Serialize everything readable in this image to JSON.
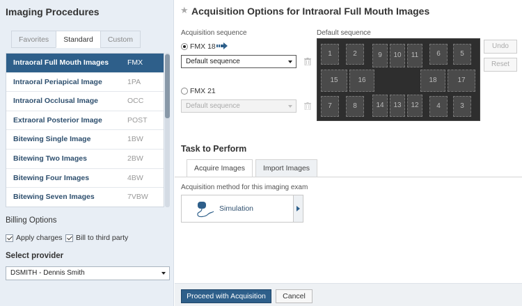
{
  "left": {
    "title": "Imaging Procedures",
    "tabs": [
      "Favorites",
      "Standard",
      "Custom"
    ],
    "procedures": [
      {
        "name": "Intraoral Full Mouth Images",
        "code": "FMX",
        "selected": true
      },
      {
        "name": "Intraoral Periapical Image",
        "code": "1PA"
      },
      {
        "name": "Intraoral Occlusal Image",
        "code": "OCC"
      },
      {
        "name": "Extraoral Posterior Image",
        "code": "POST"
      },
      {
        "name": "Bitewing Single Image",
        "code": "1BW"
      },
      {
        "name": "Bitewing Two Images",
        "code": "2BW"
      },
      {
        "name": "Bitewing Four Images",
        "code": "4BW"
      },
      {
        "name": "Bitewing Seven Images",
        "code": "7VBW"
      }
    ],
    "billing_title": "Billing Options",
    "apply_charges": "Apply charges",
    "bill_third_party": "Bill to third party",
    "provider_title": "Select provider",
    "provider_value": "DSMITH - Dennis Smith"
  },
  "main": {
    "title": "Acquisition Options for Intraoral Full Mouth Images",
    "acq_seq_label": "Acquisition sequence",
    "default_seq_label": "Default sequence",
    "option1_label": "FMX 18",
    "option1_select": "Default sequence",
    "option2_label": "FMX 21",
    "option2_select": "Default sequence",
    "undo": "Undo",
    "reset": "Reset",
    "grid_numbers": [
      "1",
      "2",
      "9",
      "10",
      "11",
      "6",
      "5",
      "15",
      "16",
      "18",
      "17",
      "7",
      "8",
      "14",
      "13",
      "12",
      "4",
      "3"
    ],
    "task_title": "Task to Perform",
    "task_tabs": [
      "Acquire Images",
      "Import Images"
    ],
    "method_label": "Acquisition method for this imaging exam",
    "method_name": "Simulation",
    "proceed": "Proceed with Acquisition",
    "cancel": "Cancel"
  },
  "colors": {
    "accent": "#2e5f8a",
    "panel_bg": "#e8eef5",
    "grid_bg": "#2e2e2e"
  }
}
